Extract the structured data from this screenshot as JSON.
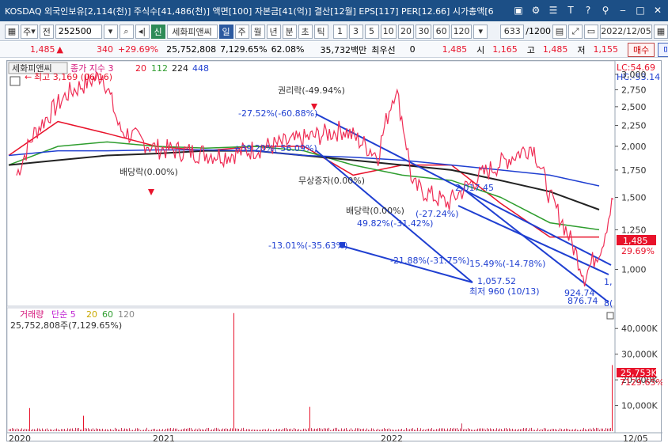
{
  "title": "KOSDAQ 외국인보유[2,114(천)] 주식수[41,486(천)] 액면[100] 자본금[41(억)] 결산[12월] EPS[117] PER[12.66] 시가총액[6",
  "title_icons": [
    "window-icon",
    "settings-icon",
    "list-icon",
    "help-t-icon",
    "help-question-icon",
    "pin-icon",
    "minimize-icon",
    "maximize-icon",
    "close-icon"
  ],
  "toolbar": {
    "type_label": "주",
    "jeon_label": "전",
    "code": "252500",
    "new_badge": "신",
    "stock_name": "세화피앤씨",
    "periods": [
      "일",
      "주",
      "월",
      "년",
      "분",
      "초",
      "틱"
    ],
    "active_period": "일",
    "intervals": [
      "1",
      "3",
      "5",
      "10",
      "20",
      "30",
      "60",
      "120"
    ],
    "count": "633",
    "count_total": "/1200",
    "date": "2022/12/05"
  },
  "infobar": {
    "price": "1,485",
    "change": "340",
    "change_pct": "+29.69%",
    "volume": "25,752,808",
    "volume_pct": "7,129.65%",
    "turnover": "62.08%",
    "amount": "35,732백만",
    "pref_label": "최우선",
    "pref_value": "0",
    "ask_price": "1,485",
    "open_label": "시",
    "open_value": "1,165",
    "high_label": "고",
    "high_value": "1,485",
    "low_label": "저",
    "low_value": "1,155",
    "buy_label": "매수",
    "sell_label": "매도"
  },
  "chart": {
    "stock_tab": "세화피앤씨",
    "legend_label": "종가 지수 3",
    "ma_labels": [
      "20",
      "112",
      "224",
      "448"
    ],
    "ma_colors": [
      "#e8132b",
      "#2e9d2e",
      "#222222",
      "#1f3fd1"
    ],
    "lc_label": "LC:54.69",
    "hc_label": "HC:-53.14",
    "high_annot": "최고 3,169 (06/16)",
    "low_annot": "최저 960 (10/13)",
    "ex_rights": "권리락(-49.94%)",
    "dividend_ex1": "배당락(0.00%)",
    "dividend_ex2": "배당락(0.00%)",
    "free_issue": "무상증자(0.00%)",
    "annot_peak": "-27.52%(-60.88%)",
    "annot_rise": "+39.20%(-56.09%)",
    "annot_low": "-13.01%(-35.63%)",
    "annot_mid": "49.82%(-31.42%)",
    "annot_mid2": "(-27.24%)",
    "annot_fall": "-21.88%(-31.75%)",
    "annot_fall2": "-15.49%(-14.78%)",
    "annot_2017": "2,017.45",
    "annot_1057": "1,057.52",
    "annot_924": "924.74",
    "annot_876": "876.74",
    "price_tag": "1,485",
    "price_pct_tag": "29.69%",
    "y_ticks": [
      "3,000",
      "2,750",
      "2,500",
      "2,250",
      "2,000",
      "1,750",
      "1,500",
      "1,250",
      "1,000"
    ],
    "x_labels": [
      "2020",
      "2021",
      "2022",
      "12/05"
    ],
    "vol_legend_label": "거래량",
    "vol_ma_label": "단순 5",
    "vol_ma_values": [
      "20",
      "60",
      "120"
    ],
    "vol_ma_colors": [
      "#c026d3",
      "#c9a800",
      "#2e9d2e",
      "#888888"
    ],
    "vol_info": "25,752,808주(7,129.65%)",
    "vol_ticks": [
      "40,000K",
      "30,000K",
      "20,000K",
      "10,000K"
    ],
    "vol_tag": "25,753K",
    "vol_pct_tag": "7129.65%",
    "right_edge_a": "1,",
    "right_edge_b": "8("
  },
  "chart_data": {
    "type": "line",
    "title": "",
    "ylim": [
      850,
      3150
    ],
    "y_scale": "log",
    "x_range": [
      "2020-01",
      "2022-12-05"
    ],
    "close_series": [
      {
        "date": "2020-01",
        "value": 1700
      },
      {
        "date": "2020-02",
        "value": 2150
      },
      {
        "date": "2020-04",
        "value": 2700
      },
      {
        "date": "2020-06",
        "value": 3000
      },
      {
        "date": "2020-07",
        "value": 2200
      },
      {
        "date": "2020-09",
        "value": 1980
      },
      {
        "date": "2021-01",
        "value": 1900
      },
      {
        "date": "2021-05",
        "value": 2050
      },
      {
        "date": "2021-08",
        "value": 2200
      },
      {
        "date": "2021-10",
        "value": 1900
      },
      {
        "date": "2021-11",
        "value": 2780
      },
      {
        "date": "2021-12",
        "value": 1600
      },
      {
        "date": "2022-02",
        "value": 1450
      },
      {
        "date": "2022-04",
        "value": 1700
      },
      {
        "date": "2022-07",
        "value": 2010
      },
      {
        "date": "2022-08",
        "value": 1500
      },
      {
        "date": "2022-10",
        "value": 960
      },
      {
        "date": "2022-11",
        "value": 1150
      },
      {
        "date": "2022-12-05",
        "value": 1485
      }
    ],
    "ma_series": [
      {
        "name": "20",
        "values": [
          1900,
          2300,
          2150,
          2000,
          1950,
          2000,
          2000,
          1700,
          1800,
          1800,
          1450,
          1200,
          1200
        ]
      },
      {
        "name": "112",
        "values": [
          1800,
          2000,
          2050,
          2000,
          1980,
          2000,
          1950,
          1800,
          1700,
          1650,
          1500,
          1300,
          1250
        ]
      },
      {
        "name": "224",
        "values": [
          1800,
          1850,
          1900,
          1920,
          1950,
          1950,
          1900,
          1850,
          1800,
          1750,
          1650,
          1550,
          1400
        ]
      },
      {
        "name": "448",
        "values": [
          1900,
          1950,
          1950,
          1960,
          1960,
          1950,
          1900,
          1880,
          1850,
          1800,
          1750,
          1700,
          1600
        ]
      }
    ],
    "volume_series": {
      "last_volume_k": 25753,
      "max_visible_k": 46000,
      "ylim_k": [
        0,
        45000
      ]
    }
  }
}
